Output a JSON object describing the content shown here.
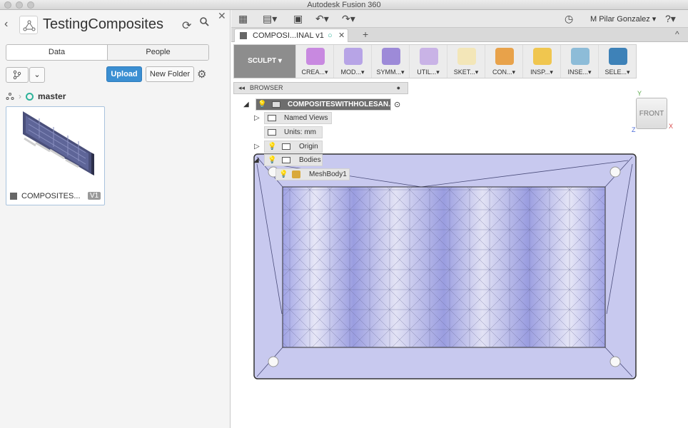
{
  "window": {
    "title": "Autodesk Fusion 360"
  },
  "data_panel": {
    "project_title": "TestingComposites",
    "tabs": [
      "Data",
      "People"
    ],
    "upload_label": "Upload",
    "new_folder_label": "New Folder",
    "breadcrumb_branch": "master",
    "file_card": {
      "name": "COMPOSITES...",
      "version": "V1"
    }
  },
  "appbar": {
    "user": "M Pilar Gonzalez ▾",
    "help": "?▾"
  },
  "document_tab": {
    "label": "COMPOSI...INAL v1"
  },
  "toolbar": {
    "workspace": "SCULPT ▾",
    "tools": [
      "CREA...▾",
      "MOD...▾",
      "SYMM...▾",
      "UTIL...▾",
      "SKET...▾",
      "CON...▾",
      "INSP...▾",
      "INSE...▾",
      "SELE...▾"
    ]
  },
  "browser": {
    "header": "BROWSER",
    "root": "COMPOSITESWITHHOLESAN...",
    "items": {
      "named_views": "Named Views",
      "units": "Units: mm",
      "origin": "Origin",
      "bodies": "Bodies",
      "mesh_body": "MeshBody1"
    }
  },
  "viewcube": {
    "face": "FRONT",
    "axis_x": "X",
    "axis_y": "Y",
    "axis_z": "Z"
  },
  "colors": {
    "accent_blue": "#3b8fd2",
    "mesh_fill": "#a7a9e6",
    "branch_ring": "#2fb39a"
  }
}
